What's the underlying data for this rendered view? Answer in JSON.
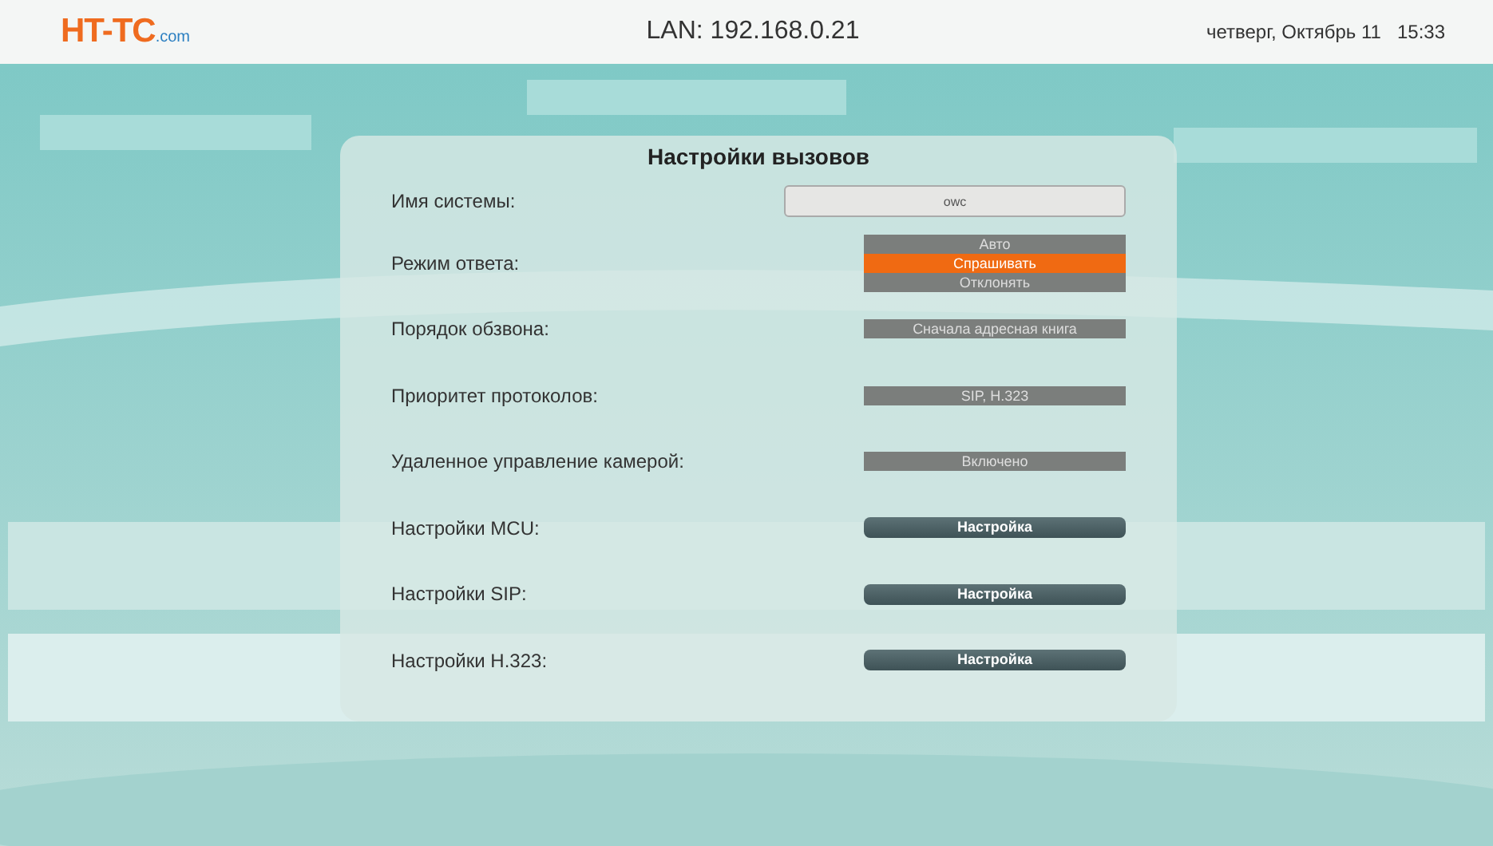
{
  "top_bar": {
    "logo": {
      "main": "HT-TC",
      "suffix": ".com"
    },
    "network": "LAN: 192.168.0.21",
    "date": "четверг, Октябрь 11",
    "time": "15:33"
  },
  "dialog": {
    "title": "Настройки вызовов",
    "rows": [
      {
        "kind": "field",
        "label": "Имя системы:",
        "value": "owc"
      },
      {
        "kind": "list",
        "label": "Режим ответа:",
        "options": [
          {
            "label": "Авто",
            "selected": false
          },
          {
            "label": "Спрашивать",
            "selected": true
          },
          {
            "label": "Отклонять",
            "selected": false
          }
        ]
      },
      {
        "kind": "value",
        "label": "Порядок обзвона:",
        "value": "Сначала адресная книга"
      },
      {
        "kind": "value",
        "label": "Приоритет протоколов:",
        "value": "SIP, H.323"
      },
      {
        "kind": "value",
        "label": "Удаленное управление камерой:",
        "value": "Включено"
      },
      {
        "kind": "button",
        "label": "Настройки MCU:",
        "value": "Настройка"
      },
      {
        "kind": "button",
        "label": "Настройки SIP:",
        "value": "Настройка"
      },
      {
        "kind": "button",
        "label": "Настройки H.323:",
        "value": "Настройка"
      }
    ]
  }
}
